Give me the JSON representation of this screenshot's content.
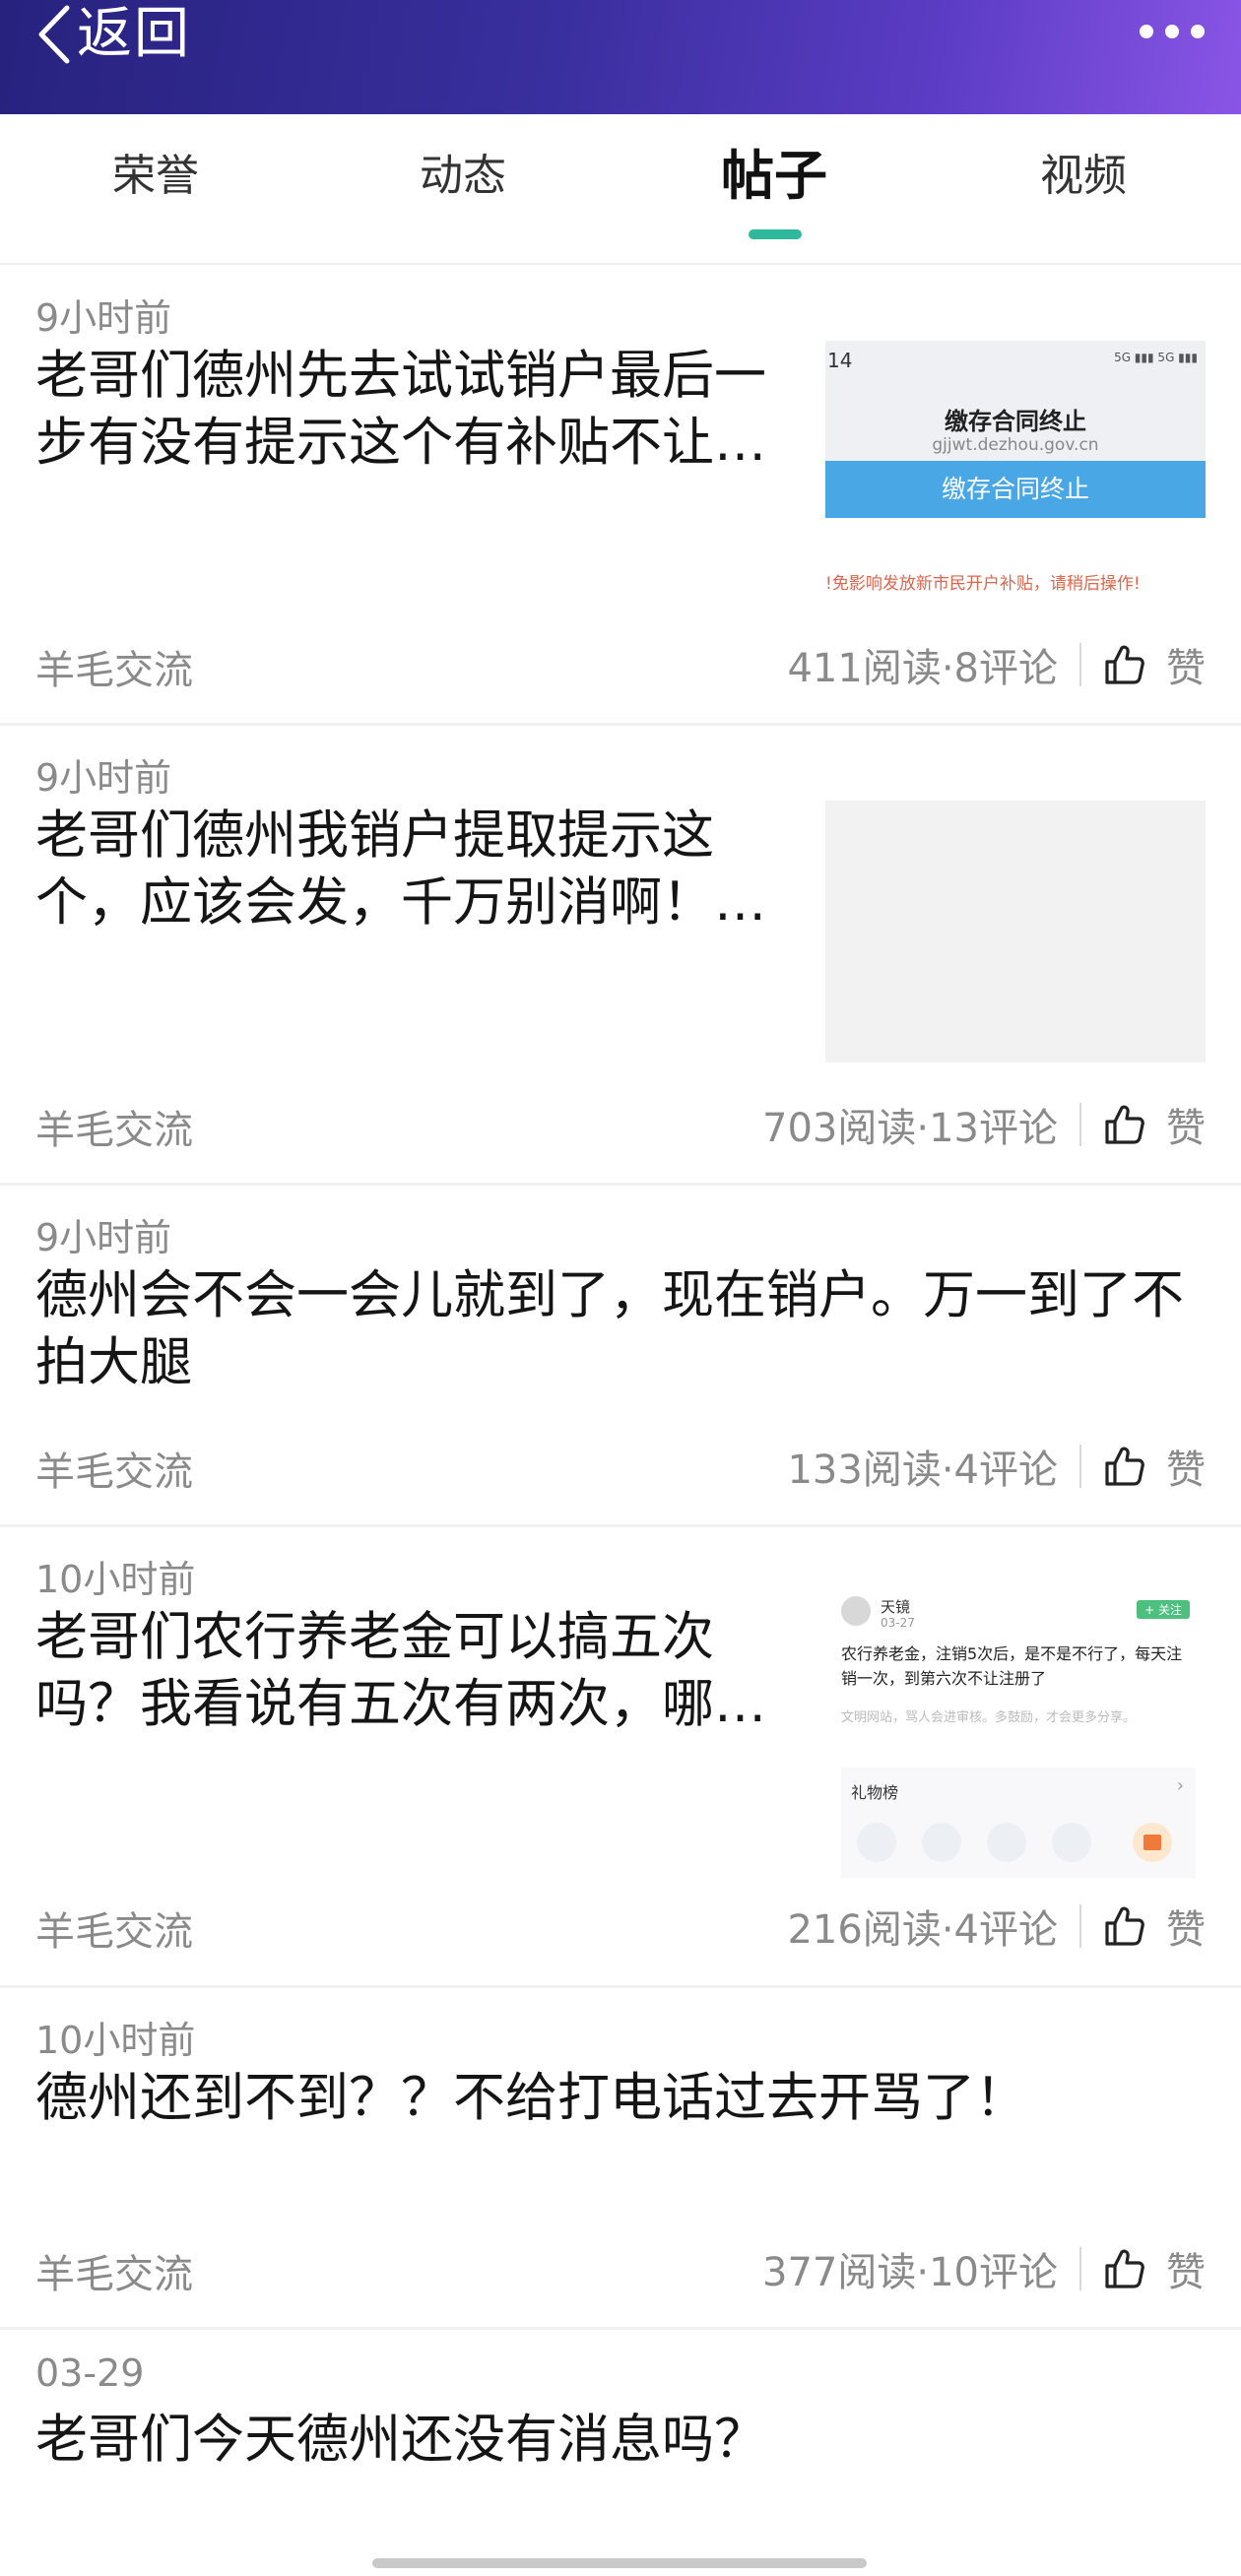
{
  "header": {
    "back_label": "返回",
    "back_icon": "chevron-left-icon",
    "more_icon": "more-dots-icon"
  },
  "tabs": [
    {
      "label": "荣誉",
      "active": false
    },
    {
      "label": "动态",
      "active": false
    },
    {
      "label": "帖子",
      "active": true
    },
    {
      "label": "视频",
      "active": false
    }
  ],
  "posts": [
    {
      "time": "9小时前",
      "title": "老哥们德州先去试试销户最后一步有没有提示这个有补贴不让…",
      "forum": "羊毛交流",
      "stats": "411阅读·8评论",
      "like_label": "赞",
      "thumb": {
        "kind": "screenshot-gov",
        "status_time": "14",
        "status_icons": "5G ▮▮▮ 5G ▮▮▮",
        "heading": "缴存合同终止",
        "domain": "gjjwt.dezhou.gov.cn",
        "button_label": "缴存合同终止",
        "warning": "!免影响发放新市民开户补贴，请稍后操作!"
      }
    },
    {
      "time": "9小时前",
      "title": "老哥们德州我销户提取提示这个，应该会发，千万别消啊！…",
      "forum": "羊毛交流",
      "stats": "703阅读·13评论",
      "like_label": "赞",
      "thumb": {
        "kind": "blank"
      }
    },
    {
      "time": "9小时前",
      "title": "德州会不会一会儿就到了，现在销户。万一到了不拍大腿",
      "forum": "羊毛交流",
      "stats": "133阅读·4评论",
      "like_label": "赞"
    },
    {
      "time": "10小时前",
      "title": "老哥们农行养老金可以搞五次吗？我看说有五次有两次，哪…",
      "forum": "羊毛交流",
      "stats": "216阅读·4评论",
      "like_label": "赞",
      "thumb": {
        "kind": "screenshot-post",
        "user": "天镜",
        "date": "03-27",
        "follow_label": "+ 关注",
        "body": "农行养老金，注销5次后，是不是不行了，每天注销一次，到第六次不让注册了",
        "hint": "文明网站，骂人会进审核。多鼓励，才会更多分享。",
        "gift_label": "礼物榜"
      }
    },
    {
      "time": "10小时前",
      "title": "德州还到不到？？不给打电话过去开骂了！",
      "forum": "羊毛交流",
      "stats": "377阅读·10评论",
      "like_label": "赞"
    },
    {
      "time": "03-29",
      "title": "老哥们今天德州还没有消息吗？"
    }
  ],
  "colors": {
    "accent": "#2eb89c",
    "header_start": "#27227e",
    "header_end": "#8a55e6"
  }
}
